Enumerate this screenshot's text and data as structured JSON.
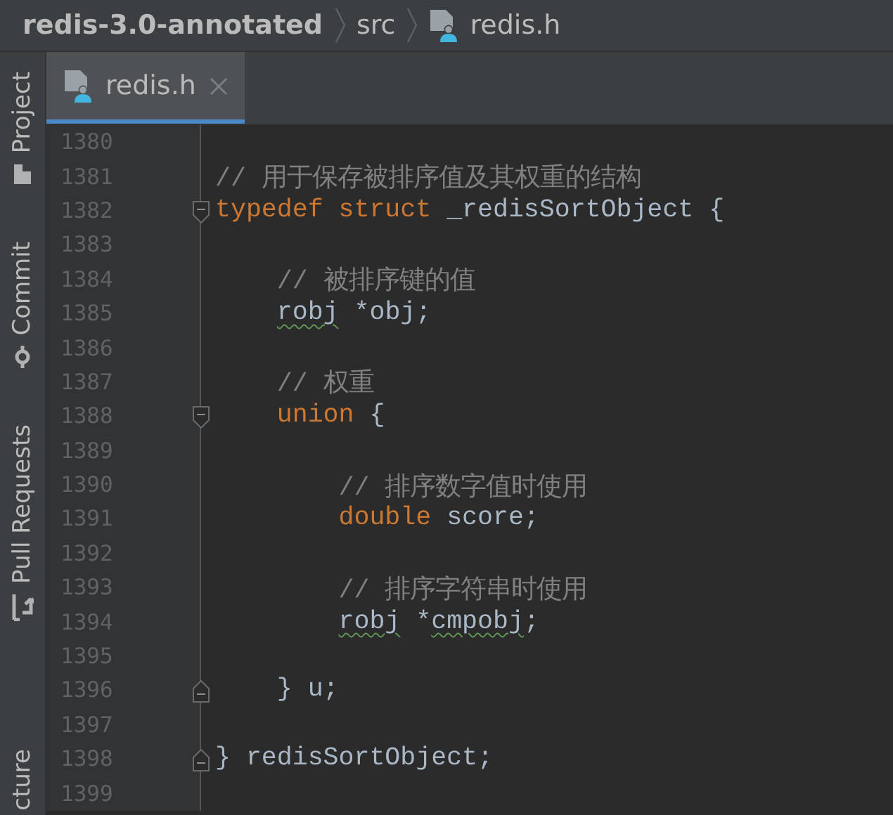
{
  "breadcrumb": [
    {
      "label": "redis-3.0-annotated",
      "kind": "project"
    },
    {
      "label": "src",
      "kind": "folder"
    },
    {
      "label": "redis.h",
      "kind": "file"
    }
  ],
  "tool_strip": [
    {
      "label": "Project",
      "kind": "project"
    },
    {
      "label": "Commit",
      "kind": "commit"
    },
    {
      "label": "Pull Requests",
      "kind": "pull"
    },
    {
      "label": "cture",
      "kind": "cut"
    }
  ],
  "tabs": [
    {
      "label": "redis.h",
      "selected": true
    }
  ],
  "lines": [
    {
      "number": "1380"
    },
    {
      "number": "1381",
      "tokens": [
        {
          "text": "// 用于保存被排序值及其权重的结构",
          "kind": "comment"
        }
      ]
    },
    {
      "number": "1382",
      "fold_start": true,
      "tokens": [
        {
          "text": "typedef",
          "kind": "keyword"
        },
        {
          "text": " struct",
          "kind": "keyword"
        },
        {
          "text": " _redisSortObject {",
          "kind": "plain"
        }
      ]
    },
    {
      "number": "1383"
    },
    {
      "number": "1384",
      "tokens": [
        {
          "text": "    // 被排序键的值",
          "kind": "comment"
        }
      ]
    },
    {
      "number": "1385",
      "tokens": [
        {
          "text": "    robj",
          "kind": "plain",
          "warning": true
        },
        {
          "text": " *obj;",
          "kind": "plain"
        }
      ]
    },
    {
      "number": "1386"
    },
    {
      "number": "1387",
      "tokens": [
        {
          "text": "    // 权重",
          "kind": "comment"
        }
      ]
    },
    {
      "number": "1388",
      "fold_start": true,
      "tokens": [
        {
          "text": "    union",
          "kind": "keyword"
        },
        {
          "text": " {",
          "kind": "plain"
        }
      ]
    },
    {
      "number": "1389"
    },
    {
      "number": "1390",
      "tokens": [
        {
          "text": "        // 排序数字值时使用",
          "kind": "comment"
        }
      ]
    },
    {
      "number": "1391",
      "tokens": [
        {
          "text": "        double",
          "kind": "keyword"
        },
        {
          "text": " score;",
          "kind": "plain"
        }
      ]
    },
    {
      "number": "1392"
    },
    {
      "number": "1393",
      "tokens": [
        {
          "text": "        // 排序字符串时使用",
          "kind": "comment"
        }
      ]
    },
    {
      "number": "1394",
      "tokens": [
        {
          "text": "        robj",
          "kind": "plain",
          "warning": true
        },
        {
          "text": " *",
          "kind": "plain"
        },
        {
          "text": "cmpobj",
          "kind": "plain",
          "warning": true
        },
        {
          "text": ";",
          "kind": "plain"
        }
      ]
    },
    {
      "number": "1395"
    },
    {
      "number": "1396",
      "fold_end": true,
      "tokens": [
        {
          "text": "    } u;",
          "kind": "plain"
        }
      ]
    },
    {
      "number": "1397"
    },
    {
      "number": "1398",
      "fold_end": true,
      "tokens": [
        {
          "text": "} redisSortObject;",
          "kind": "plain"
        }
      ]
    },
    {
      "number": "1399"
    }
  ]
}
